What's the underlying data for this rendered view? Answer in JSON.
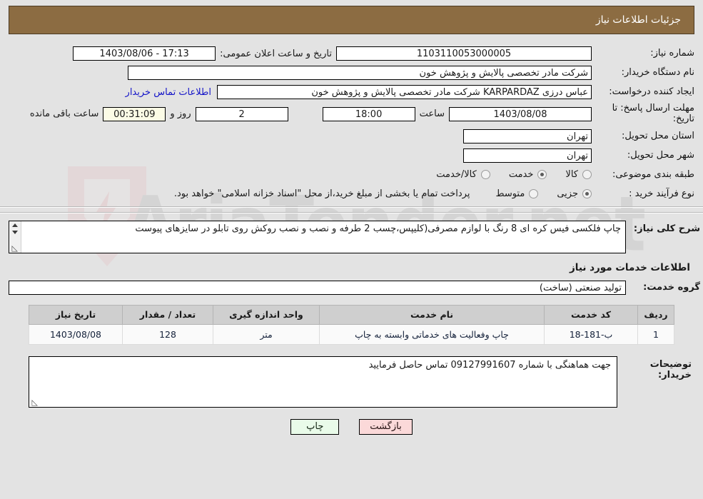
{
  "header": {
    "title": "جزئیات اطلاعات نیاز",
    "bg_color": "#8c6c42"
  },
  "watermark": {
    "text": "AriaTender.net"
  },
  "form": {
    "need_number": {
      "label": "شماره نیاز:",
      "value": "1103110053000005"
    },
    "announce_datetime": {
      "label": "تاریخ و ساعت اعلان عمومی:",
      "value": "1403/08/06 - 17:13"
    },
    "buyer_org": {
      "label": "نام دستگاه خریدار:",
      "value": "شرکت مادر تخصصی پالایش و پژوهش خون"
    },
    "request_creator": {
      "label": "ایجاد کننده درخواست:",
      "value": "عباس درزی KARPARDAZ شرکت مادر تخصصی پالایش و پژوهش خون"
    },
    "buyer_contact_link": "اطلاعات تماس خریدار",
    "deadline": {
      "label": "مهلت ارسال پاسخ: تا تاریخ:",
      "date": "1403/08/08",
      "time_label": "ساعت",
      "time": "18:00",
      "days": "2",
      "days_label": "روز و",
      "countdown": "00:31:09",
      "remaining_label": "ساعت باقی مانده"
    },
    "delivery_province": {
      "label": "استان محل تحویل:",
      "value": "تهران"
    },
    "delivery_city": {
      "label": "شهر محل تحویل:",
      "value": "تهران"
    },
    "subject_category": {
      "label": "طبقه بندی موضوعی:",
      "options": [
        {
          "label": "کالا",
          "selected": false
        },
        {
          "label": "خدمت",
          "selected": true
        },
        {
          "label": "کالا/خدمت",
          "selected": false
        }
      ]
    },
    "purchase_process": {
      "label": "نوع فرآیند خرید :",
      "options": [
        {
          "label": "جزیی",
          "selected": true
        },
        {
          "label": "متوسط",
          "selected": false
        }
      ],
      "note": "پرداخت تمام یا بخشی از مبلغ خرید،از محل \"اسناد خزانه اسلامی\" خواهد بود."
    }
  },
  "general_description": {
    "label": "شرح کلی نیاز:",
    "value": "چاپ فلکسی فیس کره ای 8 رنگ با لوازم مصرفی(کلیپس،چسب 2 طرفه و نصب و نصب روکش روی تابلو در سایزهای پیوست"
  },
  "services_section": {
    "heading": "اطلاعات خدمات مورد نیاز",
    "service_group": {
      "label": "گروه خدمت:",
      "value": "تولید صنعتی (ساخت)"
    },
    "table": {
      "columns": [
        "ردیف",
        "کد خدمت",
        "نام خدمت",
        "واحد اندازه گیری",
        "تعداد / مقدار",
        "تاریخ نیاز"
      ],
      "rows": [
        {
          "radif": "1",
          "code": "ب-181-18",
          "name": "چاپ وفعالیت های خدماتی وابسته به چاپ",
          "unit": "متر",
          "quantity": "128",
          "need_date": "1403/08/08"
        }
      ]
    }
  },
  "buyer_notes": {
    "label": "توضیحات خریدار:",
    "value": "جهت هماهنگی با شماره 09127991607 تماس حاصل فرمایید"
  },
  "buttons": {
    "print": "چاپ",
    "back": "بازگشت"
  }
}
